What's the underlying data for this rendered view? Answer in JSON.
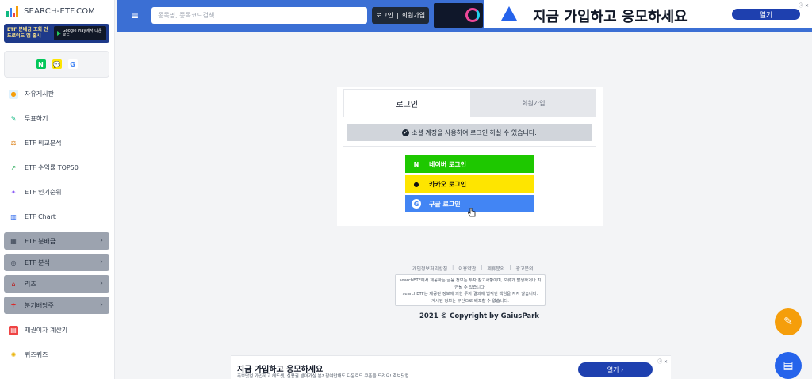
{
  "site": {
    "name": "SEARCH-ETF.COM"
  },
  "app_banner": {
    "text": "ETF 분배금 조회 안드로이드 앱 출시",
    "store": "Google Play에서 다운로드"
  },
  "social": [
    "N",
    "💬",
    "G"
  ],
  "nav": [
    {
      "label": "자유게시판",
      "icon": "chat-icon",
      "group": false
    },
    {
      "label": "투표하기",
      "icon": "vote-icon",
      "group": false
    },
    {
      "label": "ETF 비교분석",
      "icon": "scale-icon",
      "group": false
    },
    {
      "label": "ETF 수익률 TOP50",
      "icon": "chart-up-icon",
      "group": false
    },
    {
      "label": "ETF 인기순위",
      "icon": "sparkle-icon",
      "group": false
    },
    {
      "label": "ETF Chart",
      "icon": "bar-chart-icon",
      "group": false
    },
    {
      "label": "ETF 분배금",
      "icon": "calendar-icon",
      "group": true
    },
    {
      "label": "ETF 분석",
      "icon": "globe-icon",
      "group": true
    },
    {
      "label": "리츠",
      "icon": "building-icon",
      "group": true
    },
    {
      "label": "분기배당주",
      "icon": "umbrella-icon",
      "group": true
    },
    {
      "label": "채권이자 계산기",
      "icon": "calculator-icon",
      "group": false
    },
    {
      "label": "퀴즈퀴즈",
      "icon": "bulb-icon",
      "group": false
    }
  ],
  "topbar": {
    "search_placeholder": "종목명, 종목코드검색",
    "login": "로그인",
    "signup": "회원가입",
    "ad_title": "지금 가입하고 응모하세요",
    "ad_button": "열기"
  },
  "login_card": {
    "tab_login": "로그인",
    "tab_signup": "회원가입",
    "notice": "소셜 계정을 사용하여 로그인 하실 수 있습니다.",
    "naver": "네이버 로그인",
    "kakao": "카카오 로그인",
    "google": "구글 로그인"
  },
  "footer": {
    "links": [
      "개인정보처리방침",
      "이용약관",
      "제휴문의",
      "광고문의"
    ],
    "disclaimer_1": "searchETF에서 제공하는 금융 정보는 투자 참고사항이며, 오류가 발생하거나 지연될 수 있습니다.",
    "disclaimer_2": "searchETF는 제공된 정보에 의한 투자 결과에 법적인 책임을 지지 않습니다.",
    "disclaimer_3": "게시된 정보는 무단으로 배포할 수 없습니다.",
    "copyright": "2021 © Copyright by GaiusPark"
  },
  "bottom_ad": {
    "title": "지금 가입하고 응모하세요",
    "subtitle": "축보닷컴 가입하고 헤드셋, 실용권 받아가실 분? 참여만해도 다운로드 쿠폰을 드려요! 축보닷컴",
    "button": "열기 ›"
  },
  "colors": {
    "topbar": "#3b6fd4",
    "naver": "#1ec800",
    "kakao": "#fee500",
    "google": "#4285f4"
  }
}
